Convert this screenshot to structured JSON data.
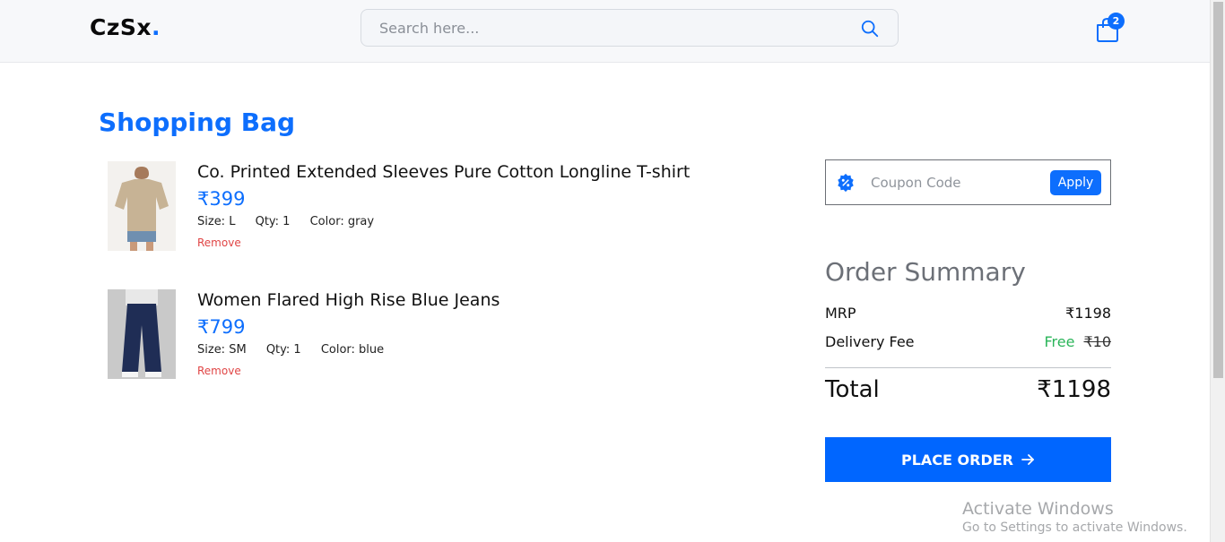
{
  "header": {
    "logo_text": "CzSx",
    "logo_dot": ".",
    "search_placeholder": "Search here...",
    "cart_count": "2"
  },
  "page_title": "Shopping Bag",
  "items": [
    {
      "name": "Co. Printed Extended Sleeves Pure Cotton Longline T-shirt",
      "price": "₹399",
      "size": "Size: L",
      "qty": "Qty: 1",
      "color": "Color: gray",
      "remove_label": "Remove"
    },
    {
      "name": "Women Flared High Rise Blue Jeans",
      "price": "₹799",
      "size": "Size: SM",
      "qty": "Qty: 1",
      "color": "Color: blue",
      "remove_label": "Remove"
    }
  ],
  "coupon": {
    "placeholder": "Coupon Code",
    "apply_label": "Apply"
  },
  "summary": {
    "title": "Order Summary",
    "mrp_label": "MRP",
    "mrp_value": "₹1198",
    "delivery_label": "Delivery Fee",
    "delivery_free": "Free",
    "delivery_original": "₹10",
    "total_label": "Total",
    "total_value": "₹1198",
    "place_order_label": "PLACE ORDER"
  },
  "watermark": {
    "line1": "Activate Windows",
    "line2": "Go to Settings to activate Windows."
  },
  "colors": {
    "accent": "#0d6efd",
    "button": "#0066ff",
    "free": "#2bb55a",
    "remove": "#e04545"
  },
  "icons": {
    "search": "search-icon",
    "cart": "shopping-bag-icon",
    "coupon": "discount-badge-icon",
    "arrow": "arrow-right-icon"
  }
}
